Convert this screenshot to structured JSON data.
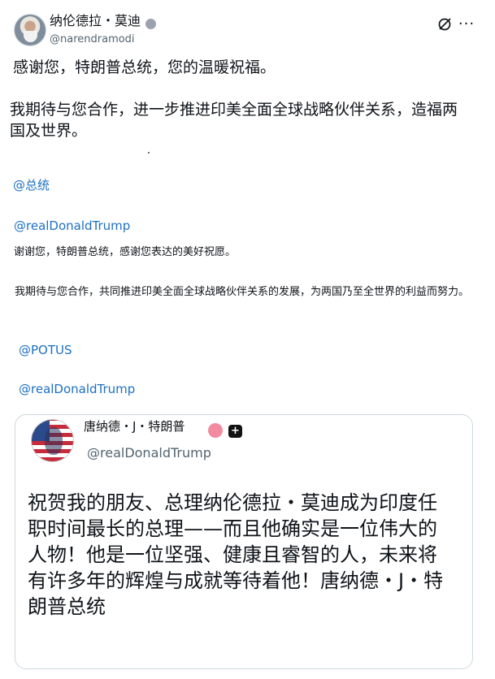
{
  "author": {
    "name": "纳伦德拉・莫迪",
    "handle": "@narendramodi",
    "avatar_icon": "profile-photo",
    "verified_color": "#9aa3ad"
  },
  "header": {
    "grok_icon": "grok-icon",
    "more_label": "···"
  },
  "post": {
    "line1": "感谢您，特朗普总统，您的温暖祝福。",
    "line2": "我期待与您合作，进一步推进印美全面全球战略伙伴关系，造福两国及世界。"
  },
  "translation": {
    "mention1": "@总统",
    "mention2": "@realDonaldTrump",
    "para1": "谢谢您，特朗普总统，感谢您表达的美好祝愿。",
    "para2": "我期待与您合作，共同推进印美全面全球战略伙伴关系的发展，为两国乃至全世界的利益而努力。",
    "mention3": "@POTUS",
    "mention4": "@realDonaldTrump"
  },
  "quote": {
    "name": "唐纳德・J・特朗普",
    "handle": "@realDonaldTrump",
    "text": "祝贺我的朋友、总理纳伦德拉・莫迪成为印度任职时间最长的总理——而且他确实是一位伟大的人物！他是一位坚强、健康且睿智的人，未来将有许多年的辉煌与成就等待着他！唐纳德・J・特朗普总统",
    "badge_color": "#f38ba0",
    "plus_label": "+"
  },
  "colors": {
    "link": "#1d70c2",
    "secondary_text": "#536471"
  }
}
